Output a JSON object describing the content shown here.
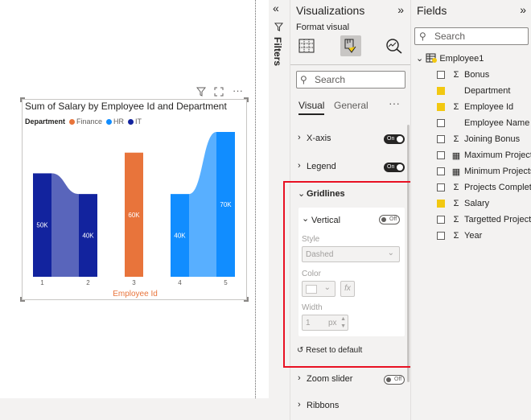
{
  "chart": {
    "title": "Sum of Salary by Employee Id and Department",
    "legend_title": "Department",
    "legend": [
      {
        "name": "Finance",
        "color": "#e8743b"
      },
      {
        "name": "HR",
        "color": "#118dff"
      },
      {
        "name": "IT",
        "color": "#12239e"
      }
    ],
    "xlabel": "Employee Id"
  },
  "chart_data": {
    "type": "bar",
    "title": "Sum of Salary by Employee Id and Department",
    "xlabel": "Employee Id",
    "ylabel": "",
    "categories": [
      "1",
      "2",
      "3",
      "4",
      "5"
    ],
    "series": [
      {
        "name": "IT",
        "color": "#12239e",
        "values": [
          50000,
          40000,
          null,
          null,
          null
        ],
        "labels": [
          "50K",
          "40K",
          "",
          "",
          ""
        ]
      },
      {
        "name": "Finance",
        "color": "#e8743b",
        "values": [
          null,
          null,
          60000,
          null,
          null
        ],
        "labels": [
          "",
          "",
          "60K",
          "",
          ""
        ]
      },
      {
        "name": "HR",
        "color": "#118dff",
        "values": [
          null,
          null,
          null,
          40000,
          70000
        ],
        "labels": [
          "",
          "",
          "",
          "40K",
          "70K"
        ]
      }
    ],
    "ylim": [
      0,
      70000
    ],
    "ribbons": true,
    "grid": false
  },
  "filters": {
    "label": "Filters"
  },
  "viz": {
    "title": "Visualizations",
    "format_visual": "Format visual",
    "search_placeholder": "Search",
    "tabs": {
      "visual": "Visual",
      "general": "General"
    },
    "sections": {
      "xaxis": {
        "label": "X-axis",
        "toggle": "On"
      },
      "legend": {
        "label": "Legend",
        "toggle": "On"
      },
      "gridlines": {
        "label": "Gridlines"
      },
      "zoom": {
        "label": "Zoom slider",
        "toggle": "Off"
      },
      "ribbons": {
        "label": "Ribbons"
      }
    },
    "gridlines": {
      "vertical_label": "Vertical",
      "vertical_toggle": "Off",
      "style_label": "Style",
      "style_value": "Dashed",
      "color_label": "Color",
      "fx": "fx",
      "width_label": "Width",
      "width_value": "1",
      "width_unit": "px",
      "reset": "Reset to default"
    }
  },
  "fields": {
    "title": "Fields",
    "search_placeholder": "Search",
    "table": "Employee1",
    "items": [
      {
        "name": "Bonus",
        "checked": false,
        "sigma": true
      },
      {
        "name": "Department",
        "checked": true,
        "sigma": false
      },
      {
        "name": "Employee Id",
        "checked": true,
        "sigma": true
      },
      {
        "name": "Employee Name",
        "checked": false,
        "sigma": false
      },
      {
        "name": "Joining Bonus",
        "checked": false,
        "sigma": true
      },
      {
        "name": "Maximum Projects",
        "checked": false,
        "sigma": false,
        "calc": true
      },
      {
        "name": "Minimum Projects",
        "checked": false,
        "sigma": false,
        "calc": true
      },
      {
        "name": "Projects Complet...",
        "checked": false,
        "sigma": true
      },
      {
        "name": "Salary",
        "checked": true,
        "sigma": true
      },
      {
        "name": "Targetted Projects",
        "checked": false,
        "sigma": true
      },
      {
        "name": "Year",
        "checked": false,
        "sigma": true
      }
    ]
  }
}
